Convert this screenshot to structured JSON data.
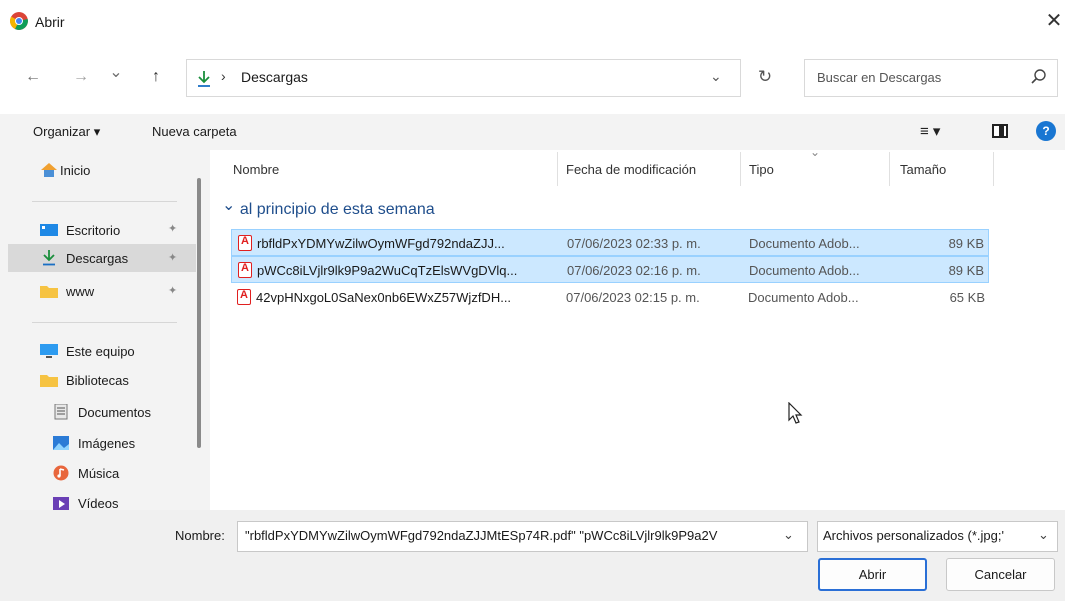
{
  "window": {
    "title": "Abrir",
    "close_glyph": "✕"
  },
  "nav": {
    "back_glyph": "←",
    "forward_glyph": "→",
    "recent_glyph": "⌄",
    "up_glyph": "↑",
    "separator": "›",
    "breadcrumb": "Descargas",
    "chevron": "⌄",
    "refresh_glyph": "↻"
  },
  "search": {
    "placeholder": "Buscar en Descargas"
  },
  "toolbar": {
    "organize": "Organizar ▾",
    "new_folder": "Nueva carpeta",
    "view_glyph": "≡ ▾",
    "help": "?"
  },
  "sidebar": {
    "items": [
      {
        "label": "Inicio",
        "icon": "home-icon",
        "pinned": false
      },
      {
        "label": "Escritorio",
        "icon": "desktop-icon",
        "pinned": true
      },
      {
        "label": "Descargas",
        "icon": "download-icon",
        "pinned": true,
        "selected": true
      },
      {
        "label": "www",
        "icon": "folder-icon",
        "pinned": true
      },
      {
        "label": "Este equipo",
        "icon": "computer-icon",
        "pinned": false
      },
      {
        "label": "Bibliotecas",
        "icon": "libraries-icon",
        "pinned": false
      },
      {
        "label": "Documentos",
        "icon": "documents-icon",
        "pinned": false
      },
      {
        "label": "Imágenes",
        "icon": "pictures-icon",
        "pinned": false
      },
      {
        "label": "Música",
        "icon": "music-icon",
        "pinned": false
      },
      {
        "label": "Vídeos",
        "icon": "videos-icon",
        "pinned": false
      }
    ],
    "pin_glyph": "📌"
  },
  "columns": {
    "name": "Nombre",
    "date": "Fecha de modificación",
    "type": "Tipo",
    "size": "Tamaño"
  },
  "group_label": "al principio de esta semana",
  "group_chevron": "⌄",
  "files": [
    {
      "name": "rbfldPxYDMYwZilwOymWFgd792ndaZJJ...",
      "date": "07/06/2023 02:33 p. m.",
      "type": "Documento Adob...",
      "size": "89 KB",
      "selected": true
    },
    {
      "name": "pWCc8iLVjlr9lk9P9a2WuCqTzElsWVgDVlq...",
      "date": "07/06/2023 02:16 p. m.",
      "type": "Documento Adob...",
      "size": "89 KB",
      "selected": true
    },
    {
      "name": "42vpHNxgoL0SaNex0nb6EWxZ57WjzfDH...",
      "date": "07/06/2023 02:15 p. m.",
      "type": "Documento Adob...",
      "size": "65 KB",
      "selected": false
    }
  ],
  "bottom": {
    "name_label": "Nombre:",
    "name_value": "\"rbfldPxYDMYwZilwOymWFgd792ndaZJJMtESp74R.pdf\" \"pWCc8iLVjlr9lk9P9a2V",
    "filter_value": "Archivos personalizados (*.jpg;'",
    "open_button": "Abrir",
    "cancel_button": "Cancelar",
    "chevron": "⌄"
  }
}
